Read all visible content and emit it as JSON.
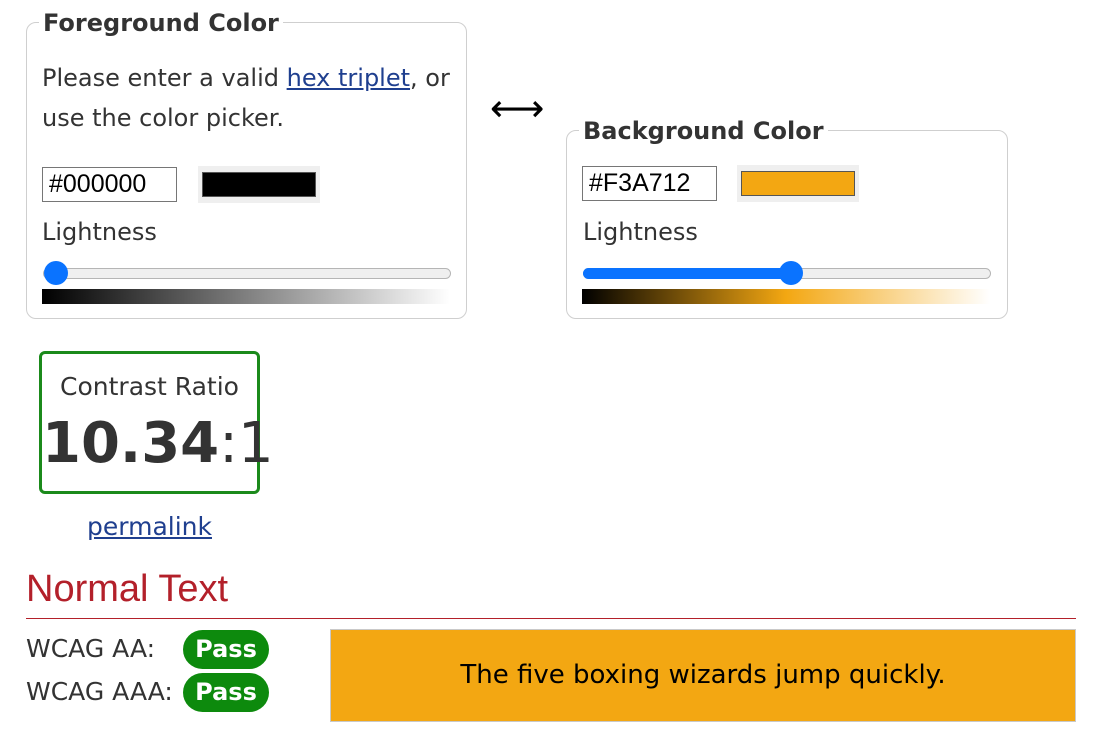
{
  "foreground": {
    "legend": "Foreground Color",
    "desc_before": "Please enter a valid ",
    "desc_link": "hex triplet",
    "desc_after": ", or use the color picker.",
    "hex_value": "#000000",
    "color": "#000000",
    "lightness_label": "Lightness",
    "lightness_percent": 0
  },
  "swap_icon": "left-right-arrow-icon",
  "background": {
    "legend": "Background Color",
    "hex_value": "#F3A712",
    "color": "#F3A712",
    "lightness_label": "Lightness",
    "lightness_percent": 51
  },
  "contrast": {
    "label": "Contrast Ratio",
    "value_bold": "10.34",
    "value_suffix": ":1",
    "border_color": "#1b8a1b"
  },
  "permalink": "permalink",
  "normal_text": {
    "title": "Normal Text",
    "aa_label": "WCAG AA:",
    "aa_result": "Pass",
    "aaa_label": "WCAG AAA:",
    "aaa_result": "Pass",
    "pass_color": "#0d8a0d",
    "sample": "The five boxing wizards jump quickly."
  }
}
